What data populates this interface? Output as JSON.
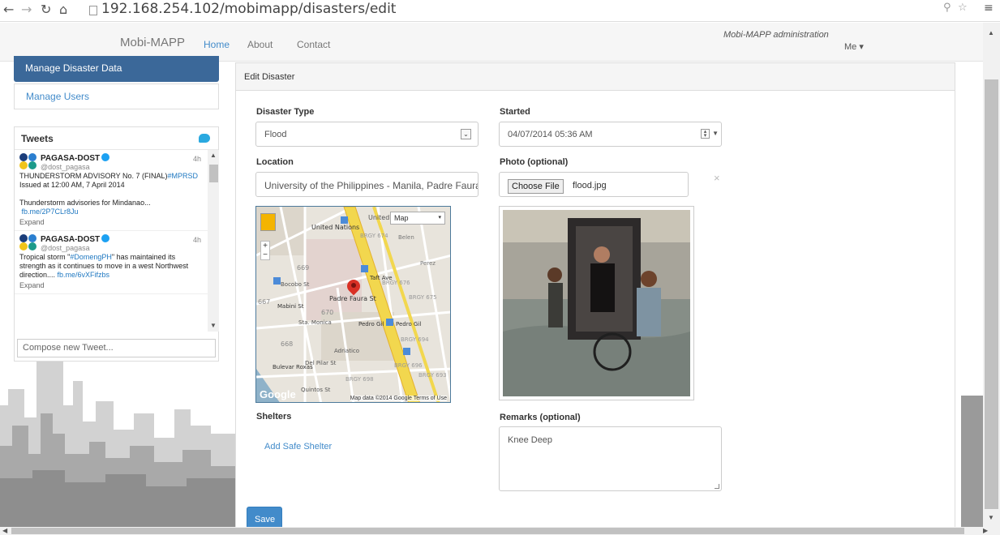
{
  "browser": {
    "url": "192.168.254.102/mobimapp/disasters/edit",
    "icons": [
      "back-icon",
      "forward-icon",
      "reload-icon",
      "home-icon",
      "page-icon",
      "zoom-icon",
      "star-icon",
      "menu-icon"
    ]
  },
  "navbar": {
    "brand": "Mobi-MAPP",
    "links": [
      "Home",
      "About",
      "Contact"
    ],
    "active_link": "Home",
    "admin_title": "Mobi-MAPP administration",
    "user_menu": "Me ▾"
  },
  "sidebar": {
    "items": [
      "Manage Disaster Data",
      "Manage Users"
    ],
    "active_item": "Manage Disaster Data"
  },
  "tweets": {
    "title": "Tweets",
    "compose_placeholder": "Compose new Tweet...",
    "items": [
      {
        "name": "PAGASA-DOST",
        "handle": "@dost_pagasa",
        "time": "4h",
        "text1": "THUNDERSTORM ADVISORY No. 7 (FINAL)",
        "hashtag1": "#MPRSD",
        "text2": "Issued at 12:00 AM, 7 April 2014",
        "text3": "Thunderstorm advisories for Mindanao...",
        "link": "fb.me/2P7CLr8Ju",
        "expand": "Expand"
      },
      {
        "name": "PAGASA-DOST",
        "handle": "@dost_pagasa",
        "time": "4h",
        "text1": "Tropical storm \"",
        "hashtag1": "#DomengPH",
        "text2": "\" has maintained its strength as it continues to move in a west Northwest direction.... ",
        "link": "fb.me/6vXFifzbs",
        "expand": "Expand"
      }
    ]
  },
  "panel": {
    "title": "Edit Disaster",
    "disaster_type_label": "Disaster Type",
    "disaster_type_value": "Flood",
    "started_label": "Started",
    "started_value": "04/07/2014 05:36 AM",
    "location_label": "Location",
    "location_value": "University of the Philippines - Manila, Padre Faura",
    "photo_label": "Photo (optional)",
    "choose_file": "Choose File",
    "file_name": "flood.jpg",
    "remove": "×",
    "shelters_label": "Shelters",
    "add_shelter": "Add Safe Shelter",
    "remarks_label": "Remarks (optional)",
    "remarks_value": "Knee Deep",
    "save": "Save"
  },
  "map": {
    "type_select": "Map",
    "credit": "Map data ©2014 Google   Terms of Use",
    "logo": "Google",
    "labels": {
      "united_nations": "United Nations",
      "padre_faura": "Padre Faura St",
      "taft": "Taft Ave",
      "pedro_gil_1": "Pedro Gil",
      "pedro_gil_2": "Pedro Gil",
      "mabini": "Mabini St",
      "brgy_674": "BRGY 674",
      "brgy_676": "BRGY 676",
      "brgy_675": "BRGY 675",
      "brgy_694": "BRGY 694",
      "brgy_696": "BRGY 696",
      "brgy_698": "BRGY 698",
      "brgy_693": "BRGY 693",
      "n669": "669",
      "n667": "667",
      "n670": "670",
      "n668": "668",
      "bocobo": "Bocobo St",
      "sta_monica": "Sta. Monica",
      "del_pilar": "Del Pilar St",
      "adriatico": "Adriatico",
      "bulevar": "Bulevar Roxas",
      "quintos": "Quintos St",
      "belen": "Belen",
      "perez": "Perez",
      "united_n": "United N"
    }
  }
}
